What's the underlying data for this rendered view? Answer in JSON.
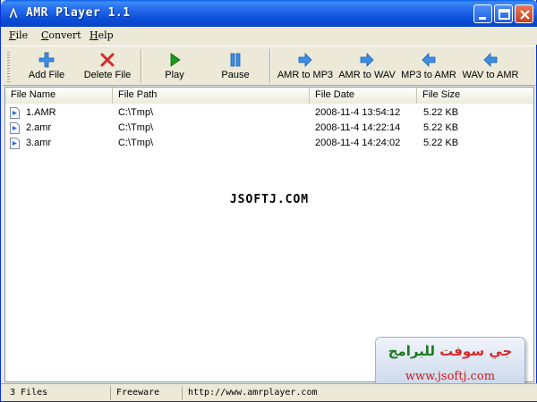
{
  "window": {
    "title": "AMR Player 1.1"
  },
  "menu": [
    {
      "label": "File",
      "key": "F",
      "rest": "ile"
    },
    {
      "label": "Convert",
      "key": "C",
      "rest": "onvert"
    },
    {
      "label": "Help",
      "key": "H",
      "rest": "elp"
    }
  ],
  "toolbar": {
    "add_file": "Add File",
    "delete_file": "Delete File",
    "play": "Play",
    "pause": "Pause",
    "amr_to_mp3": "AMR to MP3",
    "amr_to_wav": "AMR to WAV",
    "mp3_to_amr": "MP3 to AMR",
    "wav_to_amr": "WAV to AMR"
  },
  "list": {
    "columns": [
      "File Name",
      "File Path",
      "File Date",
      "File Size"
    ],
    "rows": [
      {
        "name": "1.AMR",
        "path": "C:\\Tmp\\",
        "date": "2008-11-4 13:54:12",
        "size": "5.22 KB"
      },
      {
        "name": "2.amr",
        "path": "C:\\Tmp\\",
        "date": "2008-11-4 14:22:14",
        "size": "5.22 KB"
      },
      {
        "name": "3.amr",
        "path": "C:\\Tmp\\",
        "date": "2008-11-4 14:24:02",
        "size": "5.22 KB"
      }
    ]
  },
  "watermark": "JSOFTJ.COM",
  "logo": {
    "arabic_part1": "جي سوفت",
    "arabic_part2": "للبرامج",
    "url": "www.jsoftj.com"
  },
  "status": {
    "count": "3 Files",
    "license": "Freeware",
    "url": "http://www.amrplayer.com"
  },
  "colors": {
    "titlebar": "#0a4fd8",
    "play_green": "#1a9a1a",
    "arrow_blue": "#3a8ee6",
    "delete_red": "#d42a2a"
  }
}
